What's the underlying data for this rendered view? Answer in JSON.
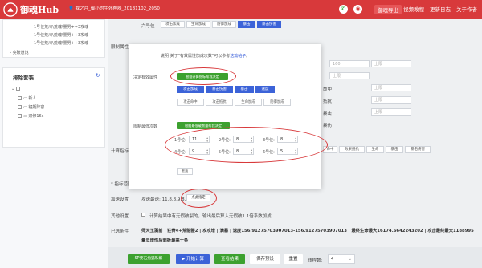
{
  "header": {
    "brand": "御魂Hub",
    "user_info": "我之月_御小的生死神器_20181102_2050",
    "nav": [
      "御魂导出",
      "视频教程",
      "更新日志",
      "关于作者"
    ]
  },
  "sidebar": {
    "scroll_lines": [
      "1号位荒川\\荒魂\\量男++3攻魂",
      "1号位荒川\\荒魂\\量男++3攻魂",
      "1号位荒川\\荒魂\\量男++3攻魂"
    ],
    "other_link": "突破道馆",
    "panel_title": "排除套装",
    "tree_items": [
      "新人",
      "镜姬阵容",
      "双修16s"
    ]
  },
  "background": {
    "slot_label": "六号位",
    "slot_tags": [
      "攻击加成",
      "生命加成",
      "防御加成",
      "暴击",
      "暴击伤害"
    ],
    "attr_label": "限制属性",
    "upper_placeholders": [
      "160",
      "上限",
      "上限",
      "上限",
      "上限",
      "上限"
    ],
    "right_stat_labels": [
      "命中",
      "抵抗",
      "暴击",
      "暴伤"
    ],
    "calc_label": "计算指标",
    "calc_tags": [
      "命中",
      "效果抵抗",
      "生命",
      "暴击",
      "暴击伤害"
    ],
    "range_label": "* 指标范围",
    "speed_label": "加速设置",
    "speed_text": "攻速最速: 11,8,8,9,8,5",
    "speed_btn": "点此指定",
    "other_label": "其他设置",
    "other_text": "计算结果中有无假破裂的，输出最后算入无假破1.1倍系数加成",
    "filter_label": "已选条件",
    "filter_text": "师天玉藻前 | 狂骨4+荒骷髅2 | 攻攻增 | 满暴 | 速度156.91275703907013-156.91275703907013 | 最终生命最大16174.6642243202 | 攻击最终最大1188995 | 量灵增伤后面板最高十条"
  },
  "modal": {
    "desc_prefix": "说明   关于\"有效属性加成次数\"可以参考",
    "desc_link": "这篇帖子",
    "desc_suffix": "。",
    "label_attr": "决定有效属性",
    "green1": "根据计算指标帮我决定",
    "attr_tags": [
      "攻击加成",
      "暴击伤害",
      "暴击",
      "速度"
    ],
    "attr_tags2": [
      "攻击命中",
      "攻击抵抗",
      "生命加成",
      "防御加成"
    ],
    "label_count": "限制最低次数",
    "green2": "根据最低破数量帮我决定",
    "slots": [
      {
        "label": "1号位:",
        "value": "11"
      },
      {
        "label": "2号位:",
        "value": "8"
      },
      {
        "label": "3号位:",
        "value": "8"
      },
      {
        "label": "4号位:",
        "value": "9"
      },
      {
        "label": "5号位:",
        "value": "8"
      },
      {
        "label": "6号位:",
        "value": "5"
      }
    ],
    "reset": "重置"
  },
  "footer": {
    "sp_btn": "SP要石指狐私帮",
    "start": "开始计算",
    "view": "查看结果",
    "save": "保存预设",
    "reset": "重置",
    "threads_label": "线程数:",
    "threads_value": "4"
  },
  "colors": {
    "header": "#d8393b",
    "green": "#3ca12f",
    "blue": "#3c63d8"
  }
}
